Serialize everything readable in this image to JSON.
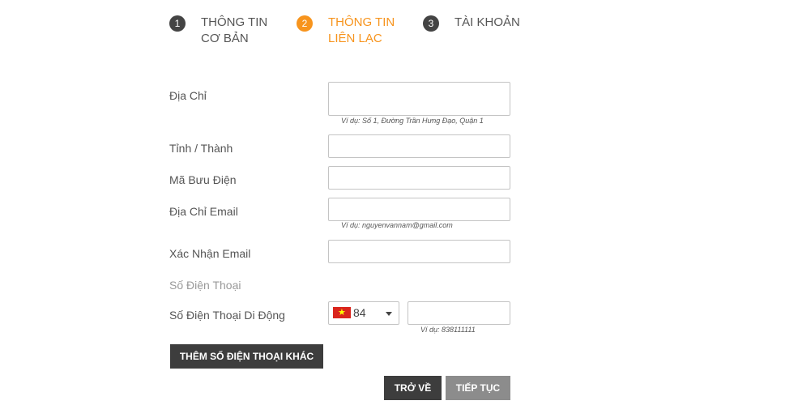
{
  "steps": [
    {
      "number": "1",
      "line1": "THÔNG TIN",
      "line2": "CƠ BẢN",
      "state": "done"
    },
    {
      "number": "2",
      "line1": "THÔNG TIN",
      "line2": "LIÊN LẠC",
      "state": "active"
    },
    {
      "number": "3",
      "line1": "TÀI KHOẢN",
      "line2": "",
      "state": "pending"
    }
  ],
  "colors": {
    "accent": "#f7941d",
    "dark": "#3d3d3d",
    "muted_button": "#8c8c8c"
  },
  "form": {
    "address": {
      "label": "Địa Chỉ",
      "value": "",
      "hint": "Ví dụ: Số 1, Đường Trần Hưng Đạo, Quận 1"
    },
    "province": {
      "label": "Tỉnh / Thành",
      "value": ""
    },
    "postal": {
      "label": "Mã Bưu Điện",
      "value": ""
    },
    "email": {
      "label": "Địa Chỉ Email",
      "value": "",
      "hint": "Ví dụ: nguyenvannam@gmail.com"
    },
    "confirm_email": {
      "label": "Xác Nhận Email",
      "value": ""
    },
    "phone_section": {
      "label": "Số Điện Thoại"
    },
    "mobile": {
      "label": "Số Điện Thoại Di Động",
      "country_code": "84",
      "country_flag_icon": "vietnam-flag-icon",
      "value": "",
      "hint": "Ví dụ: 838111111"
    }
  },
  "buttons": {
    "add_phone": "THÊM SỐ ĐIỆN THOẠI KHÁC",
    "back": "TRỞ VỀ",
    "next": "TIẾP TỤC"
  }
}
